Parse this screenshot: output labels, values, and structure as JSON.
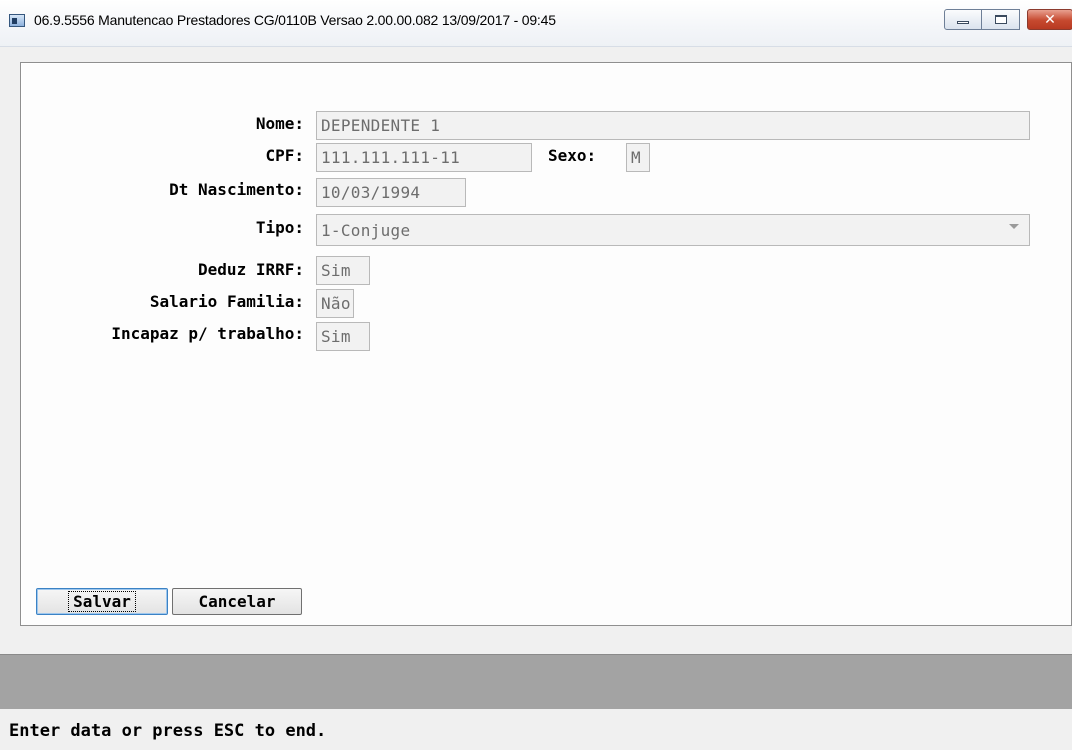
{
  "window": {
    "title": "06.9.5556 Manutencao  Prestadores CG/0110B Versao 2.00.00.082 13/09/2017 - 09:45",
    "close_symbol": "✕"
  },
  "form": {
    "nome": {
      "label": "Nome:",
      "value": "DEPENDENTE 1"
    },
    "cpf": {
      "label": "CPF:",
      "value": "111.111.111-11"
    },
    "sexo": {
      "label": "Sexo:",
      "value": "M"
    },
    "dt_nascimento": {
      "label": "Dt Nascimento:",
      "value": "10/03/1994"
    },
    "tipo": {
      "label": "Tipo:",
      "value": "1-Conjuge"
    },
    "deduz_irrf": {
      "label": "Deduz IRRF:",
      "value": "Sim"
    },
    "salario_familia": {
      "label": "Salario Familia:",
      "value": "Não"
    },
    "incapaz_trabalho": {
      "label": "Incapaz p/ trabalho:",
      "value": "Sim"
    }
  },
  "buttons": {
    "save_label": "Salvar",
    "cancel_label": "Cancelar"
  },
  "status": {
    "message": "Enter data or press ESC to end."
  },
  "icons": {
    "app": "app-window-icon",
    "minimize": "minimize-icon",
    "maximize": "maximize-icon",
    "close": "close-icon",
    "dropdown": "chevron-down-icon"
  }
}
